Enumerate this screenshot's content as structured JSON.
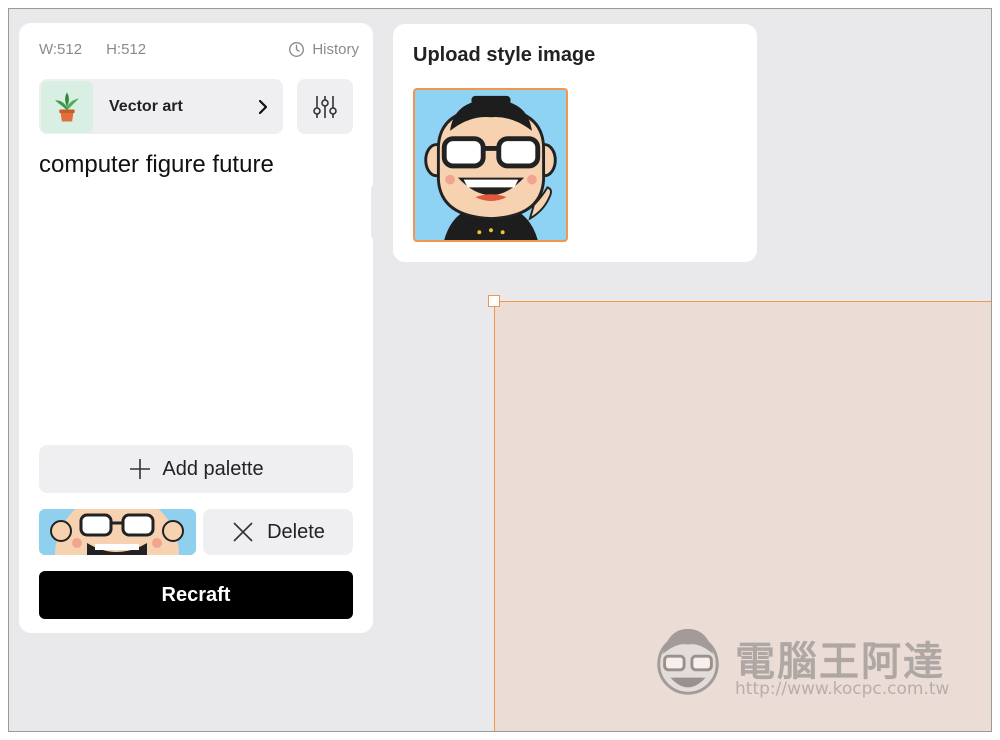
{
  "dims": {
    "width": "W:512",
    "height": "H:512"
  },
  "history": {
    "label": "History",
    "icon": "clock-icon"
  },
  "style": {
    "label": "Vector art",
    "icon": "plant-icon"
  },
  "settings": {
    "icon": "sliders-icon"
  },
  "prompt": {
    "text": "computer figure future"
  },
  "palette": {
    "add_label": "Add palette",
    "delete_label": "Delete"
  },
  "recraft": {
    "label": "Recraft"
  },
  "style_image": {
    "title": "Upload style image"
  },
  "watermark": {
    "text": "電腦王阿達",
    "url": "http://www.kocpc.com.tw"
  },
  "colors": {
    "accent": "#f3964d",
    "canvas": "#ecdcd6",
    "background": "#e9e9eb",
    "primary_button": "#000000"
  }
}
